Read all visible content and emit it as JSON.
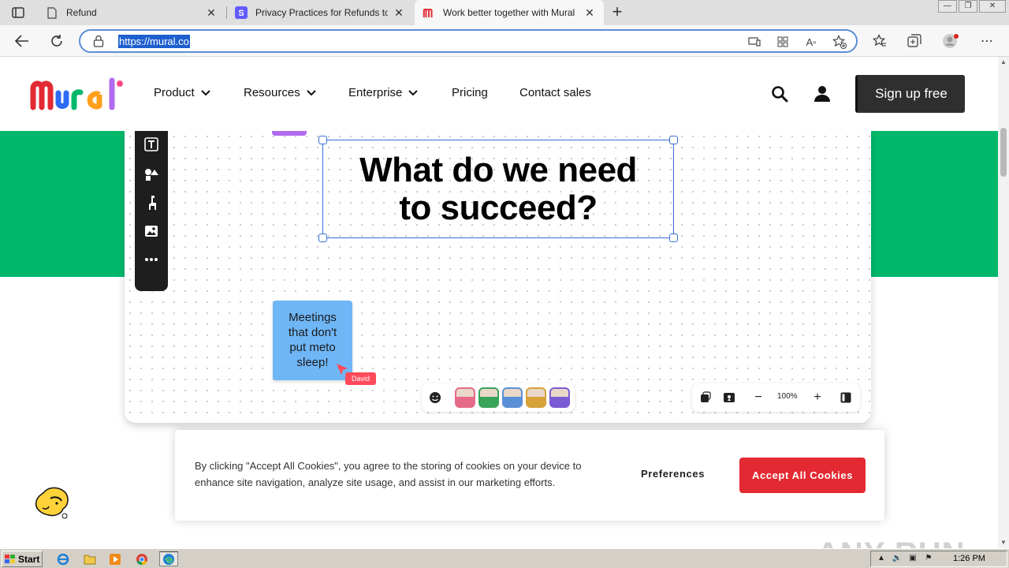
{
  "browser": {
    "tabs": [
      {
        "title": "Refund",
        "active": false
      },
      {
        "title": "Privacy Practices for Refunds to E",
        "active": false
      },
      {
        "title": "Work better together with Mural",
        "active": true
      }
    ],
    "url": "https://mural.co",
    "new_tab_label": "+",
    "window_buttons": {
      "minimize": "—",
      "restore": "❐",
      "close": "✕"
    }
  },
  "site": {
    "nav": [
      {
        "label": "Product",
        "has_dropdown": true
      },
      {
        "label": "Resources",
        "has_dropdown": true
      },
      {
        "label": "Enterprise",
        "has_dropdown": true
      },
      {
        "label": "Pricing",
        "has_dropdown": false
      },
      {
        "label": "Contact sales",
        "has_dropdown": false
      }
    ],
    "signup_label": "Sign up free",
    "colors": {
      "green_band": "#00b86b",
      "accent_red": "#e32a32",
      "sticky_blue": "#6fb6f7",
      "selection_blue": "#3a6fd8"
    }
  },
  "board": {
    "question_line1": "What do we need",
    "question_line2": "to succeed?",
    "sticky_lines": [
      "Meetings",
      "that don't",
      "put meto",
      "sleep!"
    ],
    "cursor_name": "David",
    "zoom_level": "100%",
    "zoom_minus": "−",
    "zoom_plus": "+",
    "tools": [
      "text-tool-icon",
      "shapes-tool-icon",
      "llama-tool-icon",
      "image-tool-icon",
      "more-tools-icon"
    ],
    "avatar_colors": [
      "#e66a8a",
      "#3aa35a",
      "#5b8fd6",
      "#d8a23a",
      "#7a5bd6"
    ]
  },
  "cookie_banner": {
    "text": "By clicking \"Accept All Cookies\", you agree to the storing of cookies on your device to enhance site navigation, analyze site usage, and assist in our marketing efforts.",
    "preferences_label": "Preferences",
    "accept_label": "Accept All Cookies"
  },
  "watermark": "ANY RUN",
  "taskbar": {
    "start_label": "Start",
    "clock": "1:26 PM"
  }
}
